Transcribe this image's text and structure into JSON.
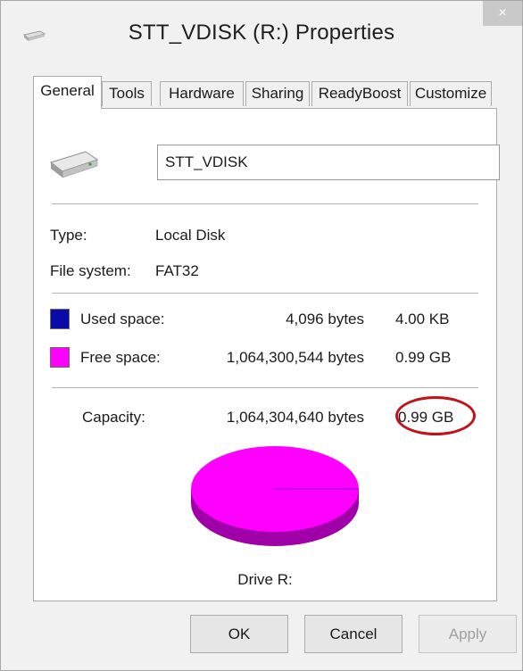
{
  "window": {
    "title": "STT_VDISK (R:) Properties",
    "close_glyph": "×"
  },
  "tabs": [
    {
      "label": "General",
      "active": true
    },
    {
      "label": "Tools"
    },
    {
      "label": "Hardware"
    },
    {
      "label": "Sharing"
    },
    {
      "label": "ReadyBoost"
    },
    {
      "label": "Customize"
    }
  ],
  "general": {
    "volume_name": "STT_VDISK",
    "type_label": "Type:",
    "type_value": "Local Disk",
    "fs_label": "File system:",
    "fs_value": "FAT32",
    "used": {
      "label": "Used space:",
      "bytes": "4,096 bytes",
      "size": "4.00 KB",
      "color": "#0a0aa8"
    },
    "free": {
      "label": "Free space:",
      "bytes": "1,064,300,544 bytes",
      "size": "0.99 GB",
      "color": "#ff00ff"
    },
    "capacity": {
      "label": "Capacity:",
      "bytes": "1,064,304,640 bytes",
      "size": "0.99 GB"
    },
    "drive_label": "Drive R:"
  },
  "pie": {
    "top_color": "#ff00ff",
    "side_color": "#a000a8",
    "used_fraction": 3.8e-06
  },
  "annotation": {
    "color": "#c0121a"
  },
  "buttons": {
    "ok": "OK",
    "cancel": "Cancel",
    "apply": "Apply"
  }
}
